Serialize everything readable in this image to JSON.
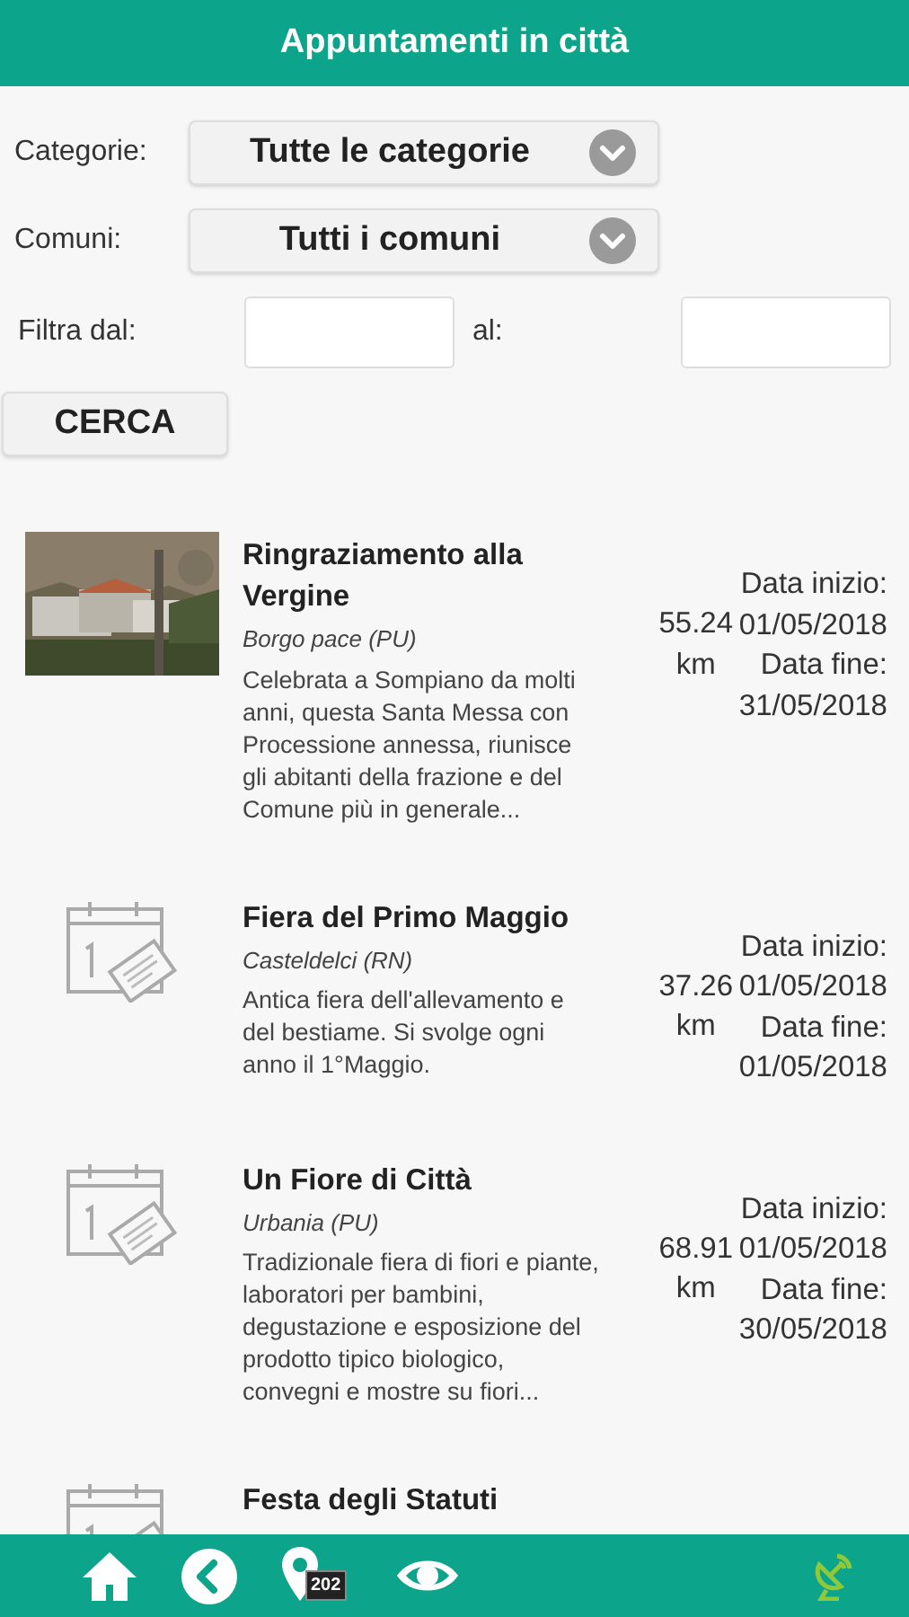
{
  "header": {
    "title": "Appuntamenti in città"
  },
  "filters": {
    "category": {
      "label": "Categorie:",
      "value": "Tutte le categorie"
    },
    "comune": {
      "label": "Comuni:",
      "value": "Tutti i comuni"
    },
    "date_from": {
      "label": "Filtra dal:"
    },
    "date_to": {
      "label": "al:"
    },
    "search_button": "CERCA"
  },
  "events": [
    {
      "title": "Ringraziamento alla Vergine",
      "place": "Borgo pace (PU)",
      "description": "Celebrata a Sompiano da molti anni, questa Santa Messa con Processione annessa, riunisce gli abitanti della frazione e del Comune più in generale...",
      "distance": "55.24 km",
      "start_label": "Data inizio:",
      "start_date": "01/05/2018",
      "end_label": "Data fine:",
      "end_date": "31/05/2018"
    },
    {
      "kind": "calendar",
      "title": "Fiera del Primo Maggio",
      "place": "Casteldelci (RN)",
      "description": "Antica fiera dell'allevamento e del bestiame.  Si svolge ogni anno il 1°Maggio.",
      "distance": "37.26 km",
      "start_label": "Data inizio:",
      "start_date": "01/05/2018",
      "end_label": "Data fine:",
      "end_date": "01/05/2018"
    },
    {
      "kind": "calendar",
      "title": "Un Fiore di Città",
      "place": "Urbania (PU)",
      "description": "Tradizionale fiera di fiori e piante, laboratori per bambini, degustazione e esposizione del prodotto tipico biologico, convegni e mostre su fiori...",
      "distance": "68.91 km",
      "start_label": "Data inizio:",
      "start_date": "01/05/2018",
      "end_label": "Data fine:",
      "end_date": "30/05/2018"
    },
    {
      "kind": "calendar",
      "title": "Festa degli Statuti"
    }
  ],
  "bottom_bar": [
    {
      "kind": "home"
    },
    {
      "kind": "back"
    },
    {
      "kind": "map",
      "badge": "202"
    },
    {
      "kind": "eye"
    },
    {
      "kind": "spacer"
    },
    {
      "kind": "satellite"
    }
  ]
}
